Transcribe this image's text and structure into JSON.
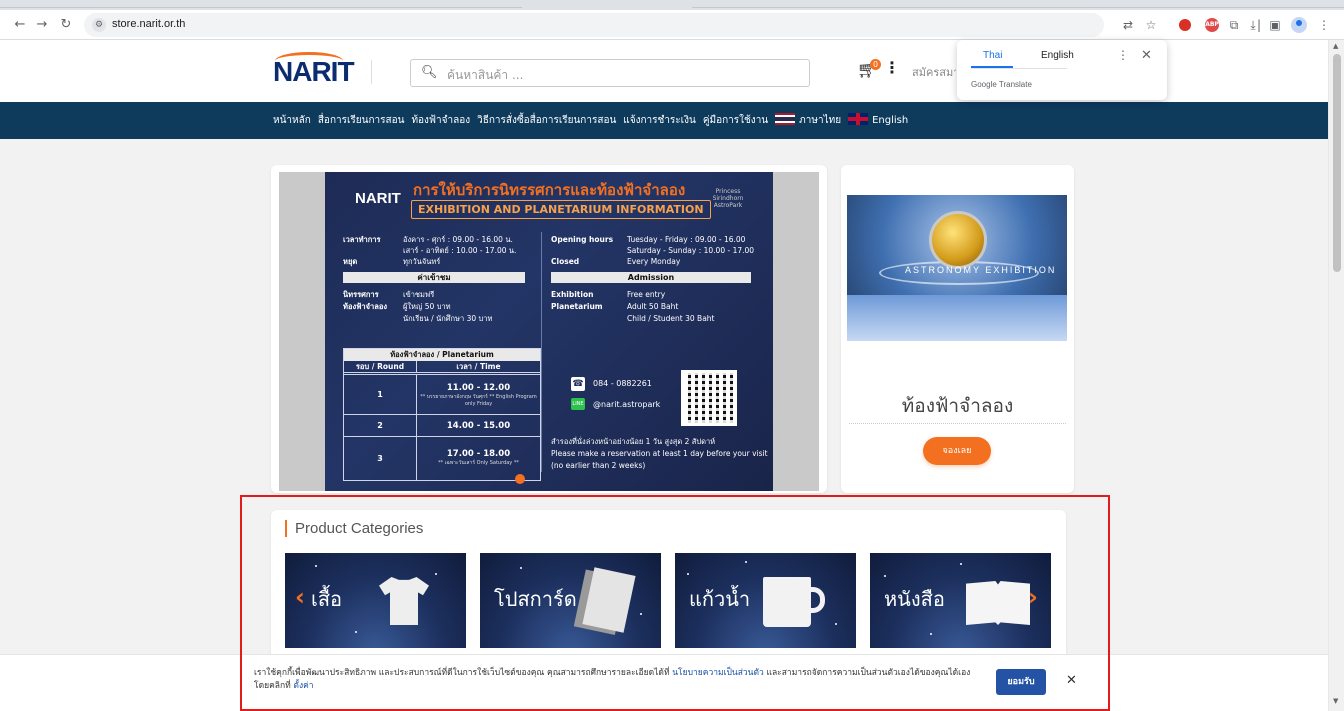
{
  "browser": {
    "url": "store.narit.or.th",
    "site_info_icon": "site-settings-icon"
  },
  "header": {
    "logo": "NARIT",
    "search_placeholder": "ค้นหาสินค้า ...",
    "cart_count": "0",
    "register_label": "สมัครสมาชิก"
  },
  "nav": {
    "items": [
      "หน้าหลัก",
      "สื่อการเรียนการสอน",
      "ท้องฟ้าจำลอง",
      "วิธีการสั่งซื้อสื่อการเรียนการสอน",
      "แจ้งการชำระเงิน",
      "คู่มือการใช้งาน"
    ],
    "lang_th": "ภาษาไทย",
    "lang_en": "English"
  },
  "translate_popup": {
    "tab_thai": "Thai",
    "tab_english": "English",
    "brand": "Google Translate"
  },
  "poster": {
    "logo": "NARIT",
    "title_th": "การให้บริการนิทรรศการและท้องฟ้าจำลอง",
    "title_en": "EXHIBITION AND PLANETARIUM INFORMATION",
    "badge": "Princess Sirindhorn AstroPark",
    "th_hours_label": "เวลาทำการ",
    "th_hours_1": "อังคาร - ศุกร์ : 09.00 - 16.00 น.",
    "th_hours_2": "เสาร์ - อาทิตย์ : 10.00 - 17.00 น.",
    "th_closed_label": "หยุด",
    "th_closed": "ทุกวันจันทร์",
    "th_admission_bar": "ค่าเข้าชม",
    "th_exhibition_label": "นิทรรศการ",
    "th_exhibition": "เข้าชมฟรี",
    "th_planetarium_label": "ท้องฟ้าจำลอง",
    "th_planetarium_1": "ผู้ใหญ่ 50 บาท",
    "th_planetarium_2": "นักเรียน / นักศึกษา 30 บาท",
    "en_hours_label": "Opening hours",
    "en_hours_1": "Tuesday - Friday : 09.00 - 16.00",
    "en_hours_2": "Saturday - Sunday : 10.00 - 17.00",
    "en_closed_label": "Closed",
    "en_closed": "Every Monday",
    "en_admission_bar": "Admission",
    "en_exhibition_label": "Exhibition",
    "en_exhibition": "Free entry",
    "en_planetarium_label": "Planetarium",
    "en_planetarium_1": "Adult 50 Baht",
    "en_planetarium_2": "Child / Student 30 Baht",
    "table_title": "ท้องฟ้าจำลอง / Planetarium",
    "col_round": "รอบ / Round",
    "col_time": "เวลา / Time",
    "rows": [
      {
        "round": "1",
        "time": "11.00 - 12.00",
        "note": "** บรรยายภาษาอังกฤษ วันศุกร์ ** English Program only Friday"
      },
      {
        "round": "2",
        "time": "14.00 - 15.00",
        "note": ""
      },
      {
        "round": "3",
        "time": "17.00 - 18.00",
        "note": "** เฉพาะวันเสาร์ Only Saturday **"
      }
    ],
    "phone": "084 - 0882261",
    "line": "@narit.astropark",
    "line_icon_label": "LINE",
    "reserve_th": "สำรองที่นั่งล่วงหน้าอย่างน้อย 1 วัน สูงสุด 2 สัปดาห์",
    "reserve_en_1": "Please make a reservation at least 1 day before your visit",
    "reserve_en_2": "(no earlier than 2 weeks)"
  },
  "side_card": {
    "image_text": "ASTRONOMY EXHIBITION",
    "title": "ท้องฟ้าจำลอง",
    "button": "จองเลย"
  },
  "categories": {
    "title": "Product Categories",
    "tiles": [
      {
        "label": "เสื้อ",
        "icon": "shirt-icon"
      },
      {
        "label": "โปสการ์ด",
        "icon": "postcard-icon"
      },
      {
        "label": "แก้วน้ำ",
        "icon": "mug-icon"
      },
      {
        "label": "หนังสือ",
        "icon": "book-icon"
      }
    ]
  },
  "cookie": {
    "text_1": "เราใช้คุกกี้เพื่อพัฒนาประสิทธิภาพ และประสบการณ์ที่ดีในการใช้เว็บไซต์ของคุณ คุณสามารถศึกษารายละเอียดได้ที่",
    "link_privacy": "นโยบายความเป็นส่วนตัว",
    "text_2": "และสามารถจัดการความเป็นส่วนตัวเองได้ของคุณได้เองโดยคลิกที่",
    "link_settings": "ตั้งค่า",
    "accept": "ยอมรับ"
  },
  "colors": {
    "nav_bg": "#0e3a5c",
    "accent": "#f37021",
    "highlight": "#e21b1b",
    "accept_btn": "#2453a6"
  }
}
